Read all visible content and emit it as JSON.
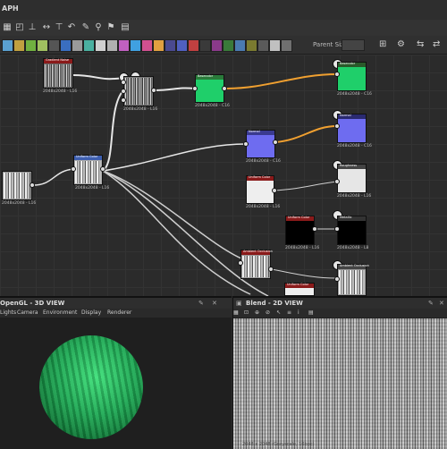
{
  "graph": {
    "title": "APH",
    "parent_size_label": "Parent Size:",
    "nodes": [
      {
        "id": "n1",
        "title": "Gradient Noise",
        "label": "2048x2048 - L16"
      },
      {
        "id": "n2",
        "title": "",
        "label": "2048x2048 - L16"
      },
      {
        "id": "n3",
        "title": "",
        "label": "2048x2048 - L16"
      },
      {
        "id": "n4",
        "title": "Uniform Color",
        "label": "2048x2048 - L16"
      },
      {
        "id": "n5",
        "title": "Basecolor",
        "label": "2048x2048 - C16"
      },
      {
        "id": "n6",
        "title": "Normal",
        "label": "2048x2048 - C16"
      },
      {
        "id": "n7",
        "title": "Normal",
        "label": "2048x2048 - C16"
      },
      {
        "id": "n8",
        "title": "Roughness",
        "label": "2048x2048 - L16"
      },
      {
        "id": "n9",
        "title": "Uniform Color",
        "label": "2048x2048 - L16"
      },
      {
        "id": "n10",
        "title": "Uniform Color",
        "label": "2048x2048 - L16"
      },
      {
        "id": "n11",
        "title": "Metallic",
        "label": "2048x2048 - L8"
      },
      {
        "id": "n12",
        "title": "Ambient Occlusion",
        "label": ""
      },
      {
        "id": "n13",
        "title": "Ambient Occlusion",
        "label": "2048x2048 - L16"
      },
      {
        "id": "n14",
        "title": "Uniform Color",
        "label": ""
      },
      {
        "id": "n15",
        "title": "",
        "label": "2048x2048 - L16"
      }
    ]
  },
  "view3d": {
    "title": "OpenGL - 3D VIEW",
    "menu": [
      "Lights",
      "Camera",
      "Environment",
      "Display",
      "Renderer"
    ]
  },
  "view2d": {
    "title": "Blend - 2D VIEW",
    "footer": "2048 x 2048 (Grayscale, 16bpc)"
  },
  "colors": {
    "accent_orange": "#f0a030",
    "node_green": "#1fcf6a",
    "node_blue": "#6e6cf0",
    "node_red_header": "#8a1a1a"
  }
}
